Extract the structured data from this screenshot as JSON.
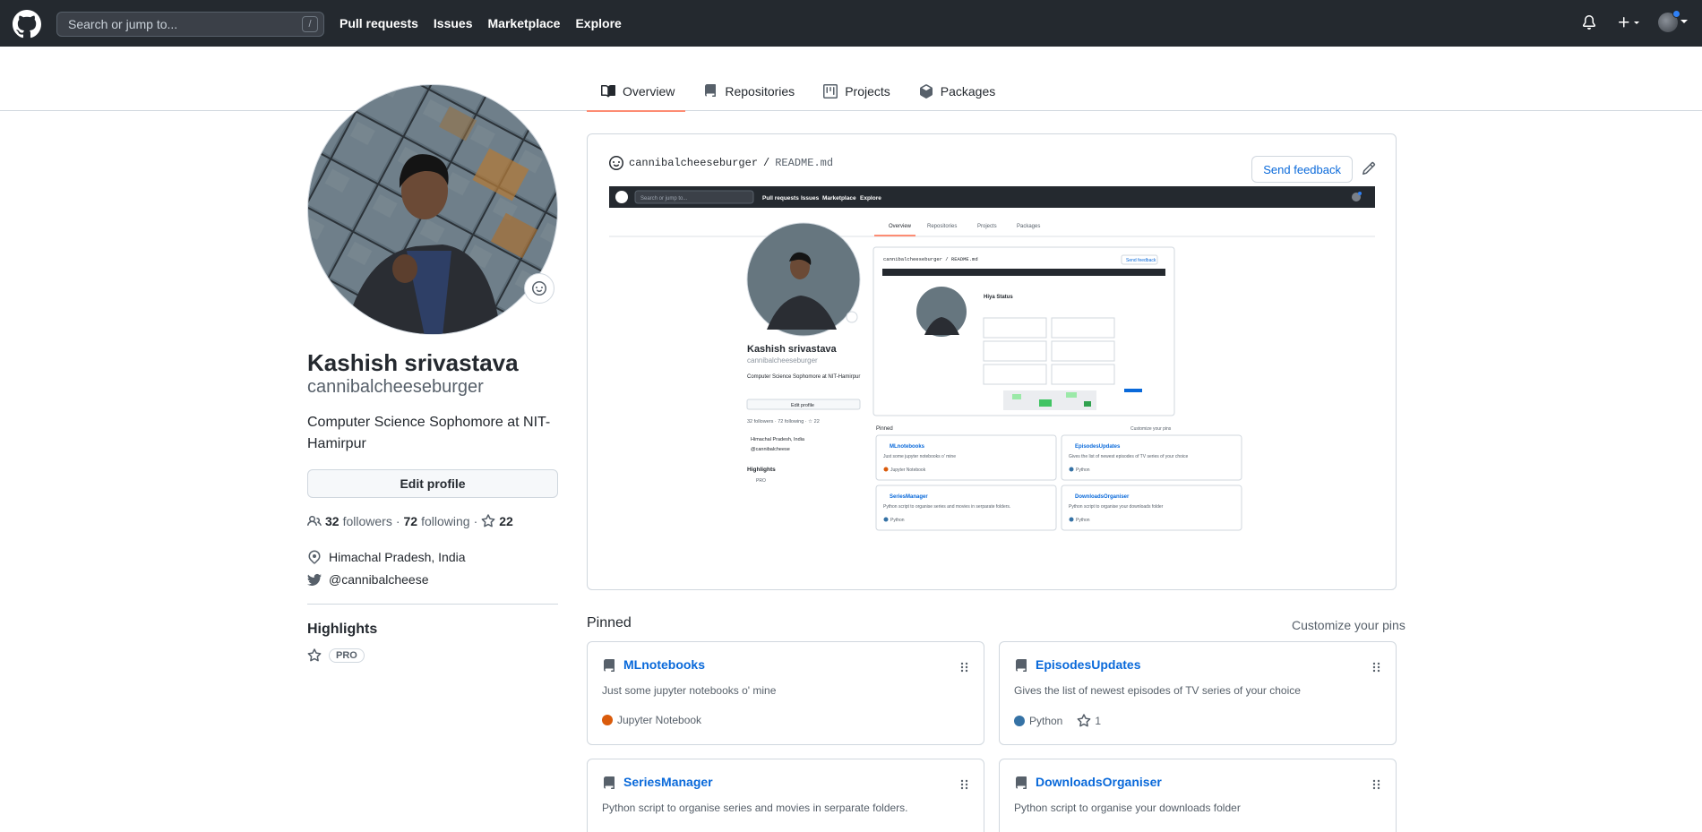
{
  "header": {
    "search_placeholder": "Search or jump to...",
    "search_shortcut": "/",
    "nav": [
      "Pull requests",
      "Issues",
      "Marketplace",
      "Explore"
    ]
  },
  "tabs": [
    {
      "label": "Overview",
      "active": true
    },
    {
      "label": "Repositories",
      "active": false
    },
    {
      "label": "Projects",
      "active": false
    },
    {
      "label": "Packages",
      "active": false
    }
  ],
  "profile": {
    "name": "Kashish srivastava",
    "login": "cannibalcheeseburger",
    "bio": "Computer Science Sophomore at NIT-Hamirpur",
    "edit_label": "Edit profile",
    "followers_count": "32",
    "followers_label": "followers",
    "dot1": "·",
    "following_count": "72",
    "following_label": "following",
    "dot2": "·",
    "stars": "22",
    "location": "Himachal Pradesh, India",
    "twitter": "@cannibalcheese"
  },
  "highlights": {
    "title": "Highlights",
    "badge": "PRO"
  },
  "readme": {
    "repo": "cannibalcheeseburger",
    "sep": "/",
    "file": "README.md",
    "feedback_label": "Send feedback"
  },
  "pinned": {
    "title": "Pinned",
    "customize": "Customize your pins",
    "repos": [
      {
        "name": "MLnotebooks",
        "desc": "Just some jupyter notebooks o' mine",
        "lang": "Jupyter Notebook",
        "lang_color": "#DA5B0B",
        "stars": ""
      },
      {
        "name": "EpisodesUpdates",
        "desc": "Gives the list of newest episodes of TV series of your choice",
        "lang": "Python",
        "lang_color": "#3572A5",
        "stars": "1"
      },
      {
        "name": "SeriesManager",
        "desc": "Python script to organise series and movies in serparate folders.",
        "lang": "",
        "lang_color": "#3572A5",
        "stars": ""
      },
      {
        "name": "DownloadsOrganiser",
        "desc": "Python script to organise your downloads folder",
        "lang": "",
        "lang_color": "#3572A5",
        "stars": ""
      }
    ]
  },
  "colors": {
    "header_bg": "#24292f",
    "link": "#0969da",
    "tab_underline": "#fd8c73"
  },
  "mini": {
    "nav": [
      "Pull requests",
      "Issues",
      "Marketplace",
      "Explore"
    ],
    "tabs": [
      "Overview",
      "Repositories",
      "Projects",
      "Packages"
    ],
    "search": "Search or jump to...",
    "name": "Kashish srivastava",
    "login": "cannibalcheeseburger",
    "bio": "Computer Science Sophomore at NIT-Hamirpur",
    "edit": "Edit profile",
    "follow": "32 followers · 72 following · ☆ 22",
    "loc": "Himachal Pradesh, India",
    "tw": "@cannibalcheese",
    "hl": "Highlights",
    "pro": "PRO",
    "readme": "cannibalcheeseburger / README.md",
    "feedback": "Send feedback",
    "pinned": "Pinned",
    "customize": "Customize your pins",
    "hiya": "Hiya Status",
    "cards": [
      {
        "n": "MLnotebooks",
        "d": "Just some jupyter notebooks o' mine",
        "l": "Jupyter Notebook"
      },
      {
        "n": "EpisodesUpdates",
        "d": "Gives the list of newest episodes of TV series of your choice",
        "l": "Python"
      },
      {
        "n": "SeriesManager",
        "d": "Python script to organise series and movies in serparate folders.",
        "l": "Python"
      },
      {
        "n": "DownloadsOrganiser",
        "d": "Python script to organise your downloads folder",
        "l": "Python"
      }
    ]
  }
}
